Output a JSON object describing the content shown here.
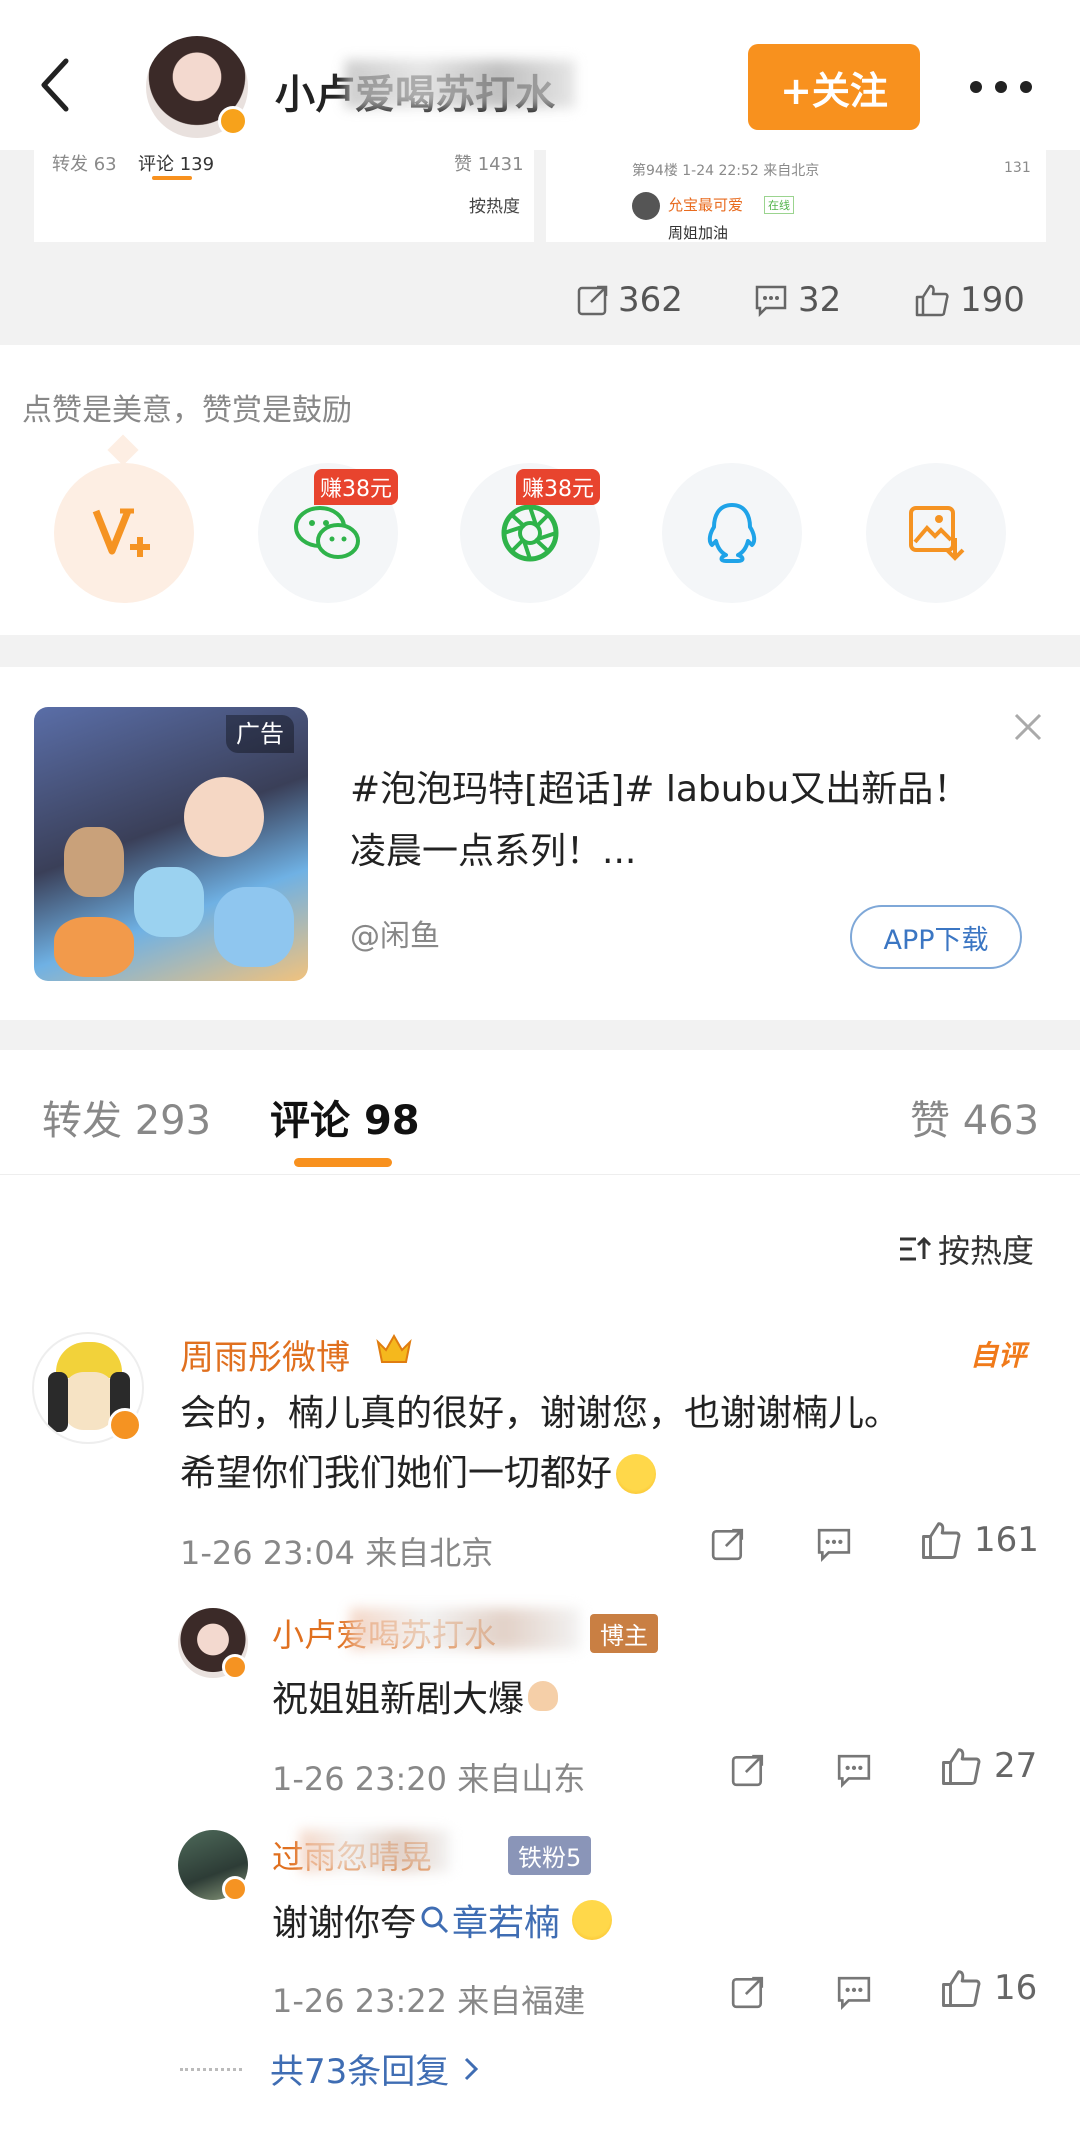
{
  "header": {
    "username": "小卢爱喝苏打水",
    "follow_label": "+关注",
    "more_icon": "more-dots-icon"
  },
  "quoted_cards": {
    "left": {
      "repost": "转发 63",
      "comment": "评论 139",
      "like": "赞 1431",
      "sort": "按热度"
    },
    "right": {
      "meta": "第94楼 1-24 22:52 来自北京",
      "likes": "131",
      "commenter": "允宝最可爱",
      "online": "在线",
      "comment": "周姐加油"
    }
  },
  "post_actions": {
    "share": "362",
    "comment": "32",
    "like": "190"
  },
  "reward": {
    "slogan": "点赞是美意，赞赏是鼓励",
    "badges": [
      "赚38元",
      "赚38元"
    ],
    "items": [
      "reward-v-plus-icon",
      "wechat-icon",
      "moments-icon",
      "qq-icon",
      "save-image-icon"
    ]
  },
  "ad": {
    "tag": "广告",
    "title": "#泡泡玛特[超话]#  labubu又出新品！凌晨一点系列！...",
    "source": "@闲鱼",
    "button": "APP下载"
  },
  "tabs": {
    "repost": {
      "label": "转发",
      "count": "293"
    },
    "comment": {
      "label": "评论",
      "count": "98"
    },
    "like": {
      "label": "赞",
      "count": "463"
    }
  },
  "sort_label": "按热度",
  "comments": [
    {
      "name": "周雨彤微博",
      "badge": "自评",
      "text_line1": "会的，楠儿真的很好，谢谢您，也谢谢楠儿。",
      "text_line2": "希望你们我们她们一切都好",
      "time": "1-26 23:04  来自北京",
      "likes": "161"
    }
  ],
  "replies": [
    {
      "name": "小卢爱喝苏打水",
      "tag": "博主",
      "text": "祝姐姐新剧大爆",
      "time": "1-26 23:20  来自山东",
      "likes": "27"
    },
    {
      "name": "过雨忽晴晃",
      "tag": "铁粉5",
      "text_prefix": "谢谢你夸",
      "mention": "章若楠",
      "time": "1-26 23:22  来自福建",
      "likes": "16"
    }
  ],
  "more_replies": "共73条回复"
}
